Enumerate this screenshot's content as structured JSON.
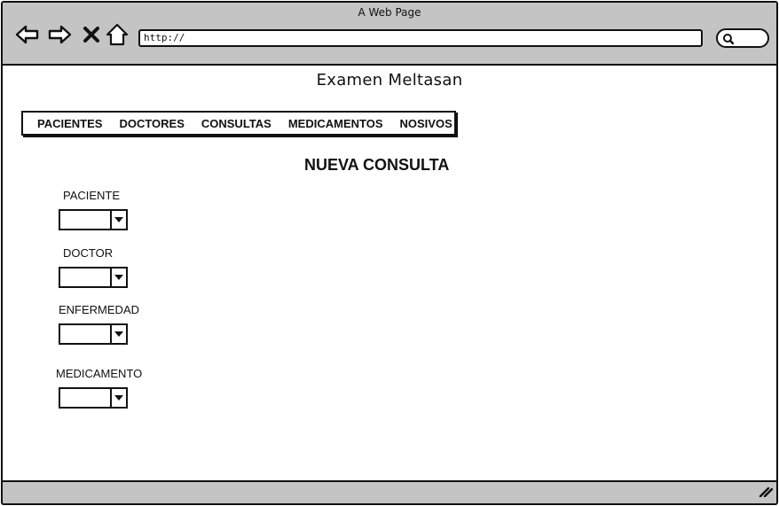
{
  "browser": {
    "window_title": "A Web Page",
    "url": "http://",
    "icons": {
      "back": "back-arrow-icon",
      "forward": "forward-arrow-icon",
      "stop": "close-icon",
      "home": "home-icon",
      "search": "search-icon",
      "resize": "resize-grip-icon"
    }
  },
  "page": {
    "title": "Examen Meltasan",
    "menu": [
      {
        "label": "PACIENTES"
      },
      {
        "label": "DOCTORES"
      },
      {
        "label": "CONSULTAS"
      },
      {
        "label": "MEDICAMENTOS"
      },
      {
        "label": "NOSIVOS"
      }
    ],
    "form": {
      "heading": "NUEVA CONSULTA",
      "fields": [
        {
          "label": "PACIENTE",
          "value": ""
        },
        {
          "label": "DOCTOR",
          "value": ""
        },
        {
          "label": "ENFERMEDAD",
          "value": ""
        },
        {
          "label": "MEDICAMENTO",
          "value": ""
        }
      ]
    }
  },
  "colors": {
    "chrome": "#c4c4c4",
    "ink": "#111111",
    "background": "#ffffff"
  }
}
